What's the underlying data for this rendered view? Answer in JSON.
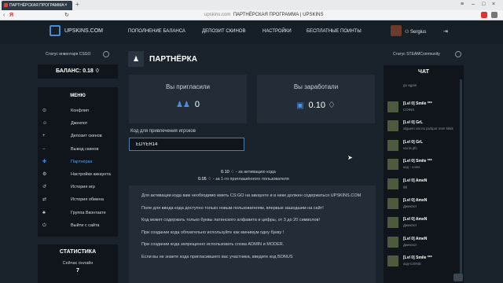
{
  "browser": {
    "tab_title": "ПАРТНЁРСКАЯ ПРОГРАММА",
    "tab_close": "×",
    "url_host": "upskins.com",
    "url_title": "ПАРТНЁРСКАЯ ПРОГРАММА | UPSKINS",
    "ya": "Я"
  },
  "header": {
    "logo": "UPSKINS.COM",
    "nav": [
      "ПОПОЛНЕНИЕ БАЛАНСА",
      "ДЕПОЗИТ СКИНОВ",
      "НАСТРОЙКИ",
      "БЕСПЛАТНЫЕ ПОИНТЫ"
    ],
    "username": "Sergius"
  },
  "left": {
    "inventory_status": "Статус инвентаря CSGO",
    "balance": "БАЛАНС: 0.18",
    "menu_title": "МЕНЮ",
    "menu": [
      {
        "label": "Конфлип",
        "icon": "⊙"
      },
      {
        "label": "Джекпот",
        "icon": "☺"
      },
      {
        "label": "Депозит скинов",
        "icon": "+"
      },
      {
        "label": "Вывод скинов",
        "icon": "−"
      },
      {
        "label": "Партнёрка",
        "icon": "✤"
      },
      {
        "label": "Настройки аккаунта",
        "icon": "⚙"
      },
      {
        "label": "История игр",
        "icon": "↺"
      },
      {
        "label": "История обмена",
        "icon": "⇄"
      },
      {
        "label": "Группа Вконтакте",
        "icon": "♣"
      },
      {
        "label": "Выйти с сайта",
        "icon": "⏻"
      }
    ],
    "active_index": 4,
    "stats_title": "СТАТИСТИКА",
    "stats_label": "Сейчас онлайн",
    "stats_value": "7"
  },
  "main": {
    "title": "ПАРТНЁРКА",
    "invited_label": "Вы пригласили",
    "invited_value": "0",
    "earned_label": "Вы заработали",
    "earned_value": "0.10",
    "code_label": "Код для привлечения игроков",
    "code_value": "EDYER14",
    "reward1_value": "0.10",
    "reward1_text": "- за активацию кода",
    "reward2_value": "0.05",
    "reward2_text": "- за 1-го приглашённого пользователя",
    "info": [
      "Для активации кода вам необходимо иметь CS:GO на аккаунте и в нике должен содержаться UPSKINS.COM",
      "Поле для ввода кода доступно только новым пользователям, впервые зашедшим на сайт!",
      "Код может содержать только буквы латинского алфавита и цифры, от 3 до 20 символов!",
      "При создании кода обязательно используйте как минимум одну букву !",
      "При создании кода запрещенно использовать слова ADMIN и MODER.",
      "Если вы не знаете кода пригласившего вас участника, введите код BONUS"
    ]
  },
  "right": {
    "steam_status": "Статус STEAMCommunity",
    "chat_title": "ЧАТ",
    "messages": [
      {
        "name": "",
        "text": "go again"
      },
      {
        "name": "[Lvl 0] Smile ***",
        "text": "COINS"
      },
      {
        "name": "[Lvl 0] GrL",
        "text": "alguem vai no jackpot mm! kkkk"
      },
      {
        "name": "[Lvl 0] GrL",
        "text": "vai la pfc"
      },
      {
        "name": "[Lvl 0] Smile ***",
        "text": "код - coins"
      },
      {
        "name": "[Lvl 0] AmeN",
        "text": "gg"
      },
      {
        "name": "[Lvl 0] AmeN",
        "text": "Джекпот"
      },
      {
        "name": "[Lvl 0] AmeN",
        "text": "Джекпот"
      },
      {
        "name": "[Lvl 0] AmeN",
        "text": "Джекпот"
      },
      {
        "name": "[Lvl 0] Smile ***",
        "text": "код-COINS"
      }
    ]
  }
}
